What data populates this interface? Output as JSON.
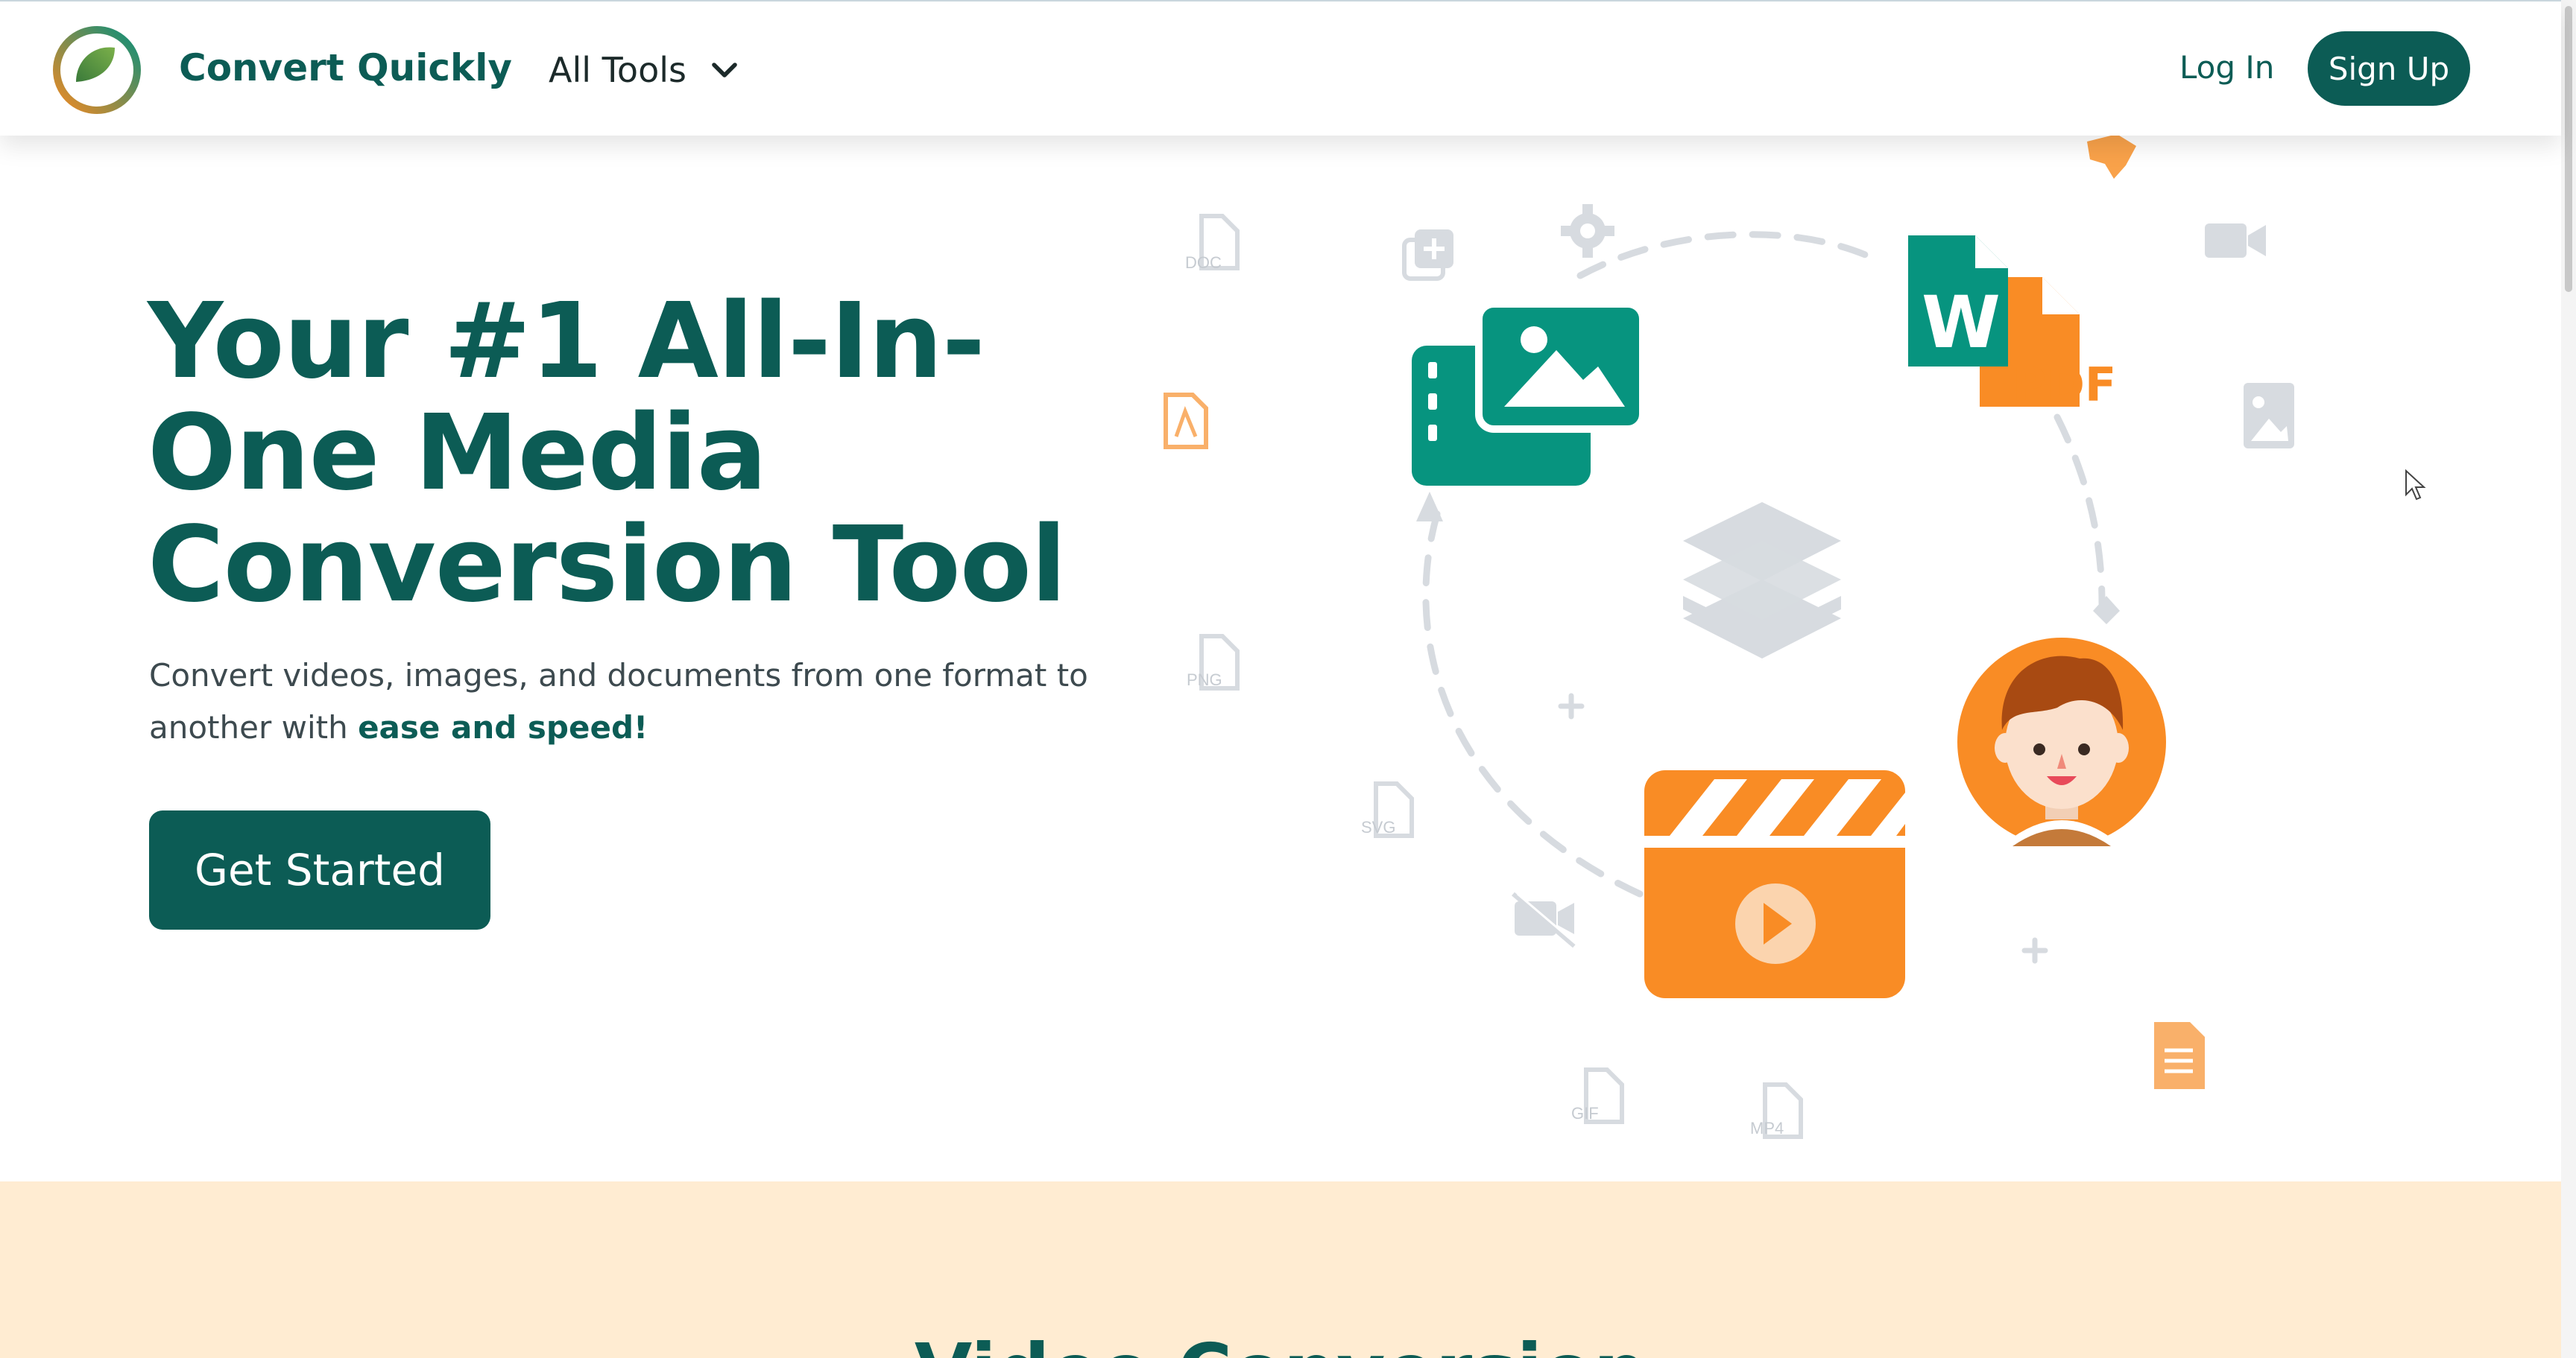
{
  "app": {
    "brand": "Convert Quickly"
  },
  "nav": {
    "all_tools_label": "All Tools",
    "login_label": "Log In",
    "signup_label": "Sign Up"
  },
  "hero": {
    "title": "Your #1 All-In-One Media Conversion Tool",
    "subtitle_prefix": "Convert videos, images, and documents from one format to another with ",
    "subtitle_emphasis": "ease and speed!",
    "cta_label": "Get Started"
  },
  "illustration": {
    "file_labels": {
      "doc": "DOC",
      "png": "PNG",
      "svg": "SVG",
      "gif": "GIF",
      "mp4": "MP4",
      "pdf": "PDF",
      "word": "W"
    }
  },
  "section": {
    "title": "Video Conversion"
  },
  "colors": {
    "primary": "#0c5c55",
    "teal": "#07947f",
    "orange": "#f98c25",
    "peach": "#ffecd2",
    "gray_icon": "#d7dbe0"
  },
  "icons": [
    "logo-mark",
    "chevron-down-icon",
    "image-file-icon",
    "word-doc-icon",
    "pdf-doc-icon",
    "layers-icon",
    "avatar",
    "video-clapper-icon",
    "gear-icon",
    "video-camera-icon",
    "no-video-icon",
    "pdf-icon",
    "text-doc-icon"
  ]
}
